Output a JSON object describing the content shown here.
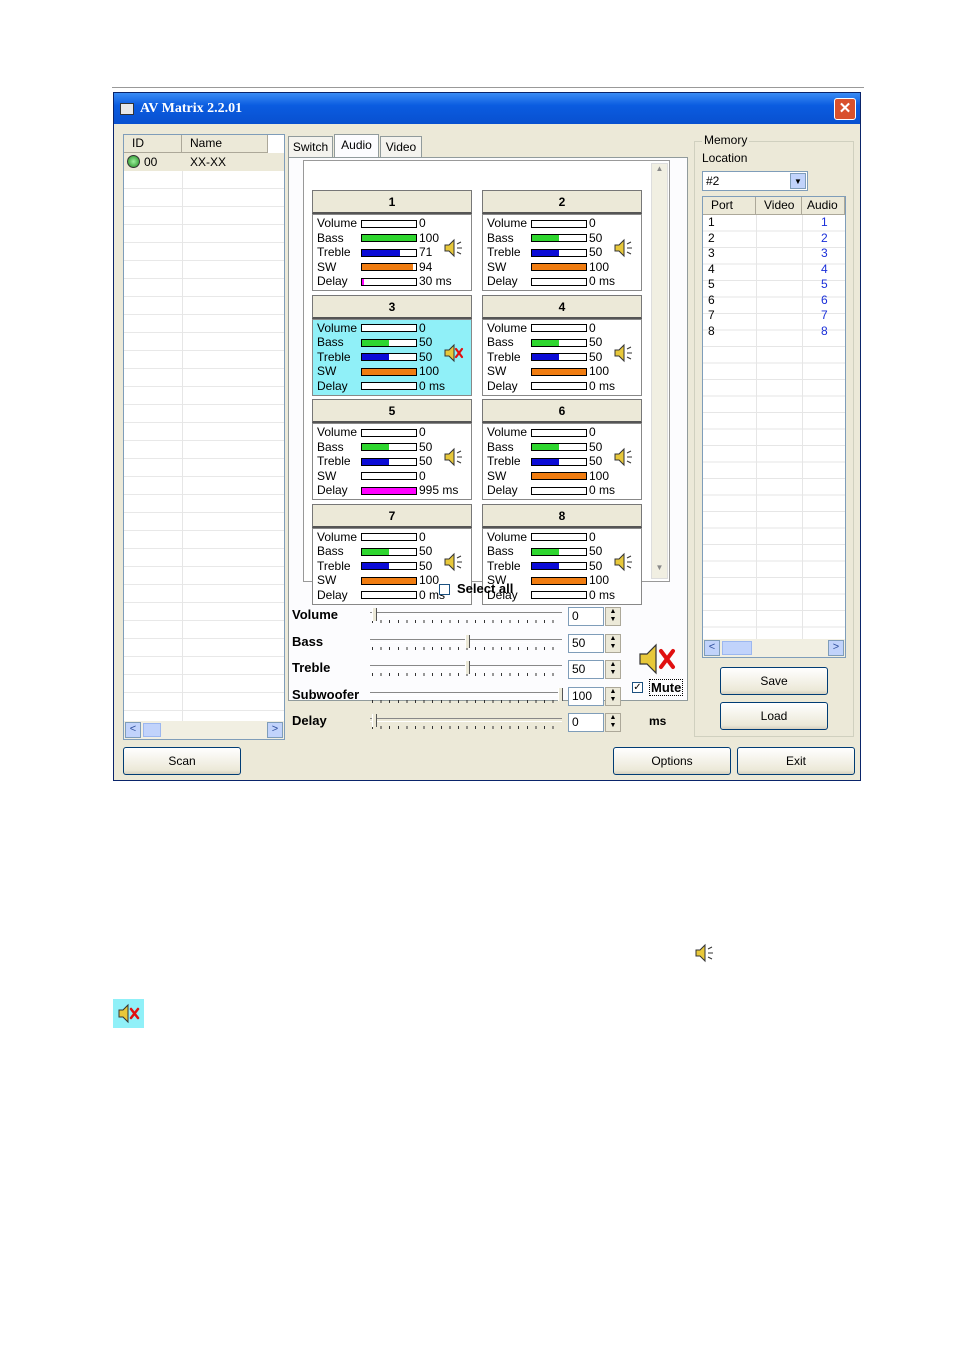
{
  "window": {
    "title": "AV Matrix 2.2.01"
  },
  "device_list": {
    "columns": [
      "ID",
      "Name"
    ],
    "rows": [
      {
        "id": "00",
        "name": "XX-XX"
      }
    ]
  },
  "tabs": [
    "Switch",
    "Audio",
    "Video"
  ],
  "selected_tab": "Audio",
  "zones": [
    {
      "title": "1",
      "volume": 0,
      "bass": 100,
      "treble": 71,
      "sw": 94,
      "delay_label": "30 ms",
      "delay_ms": 30,
      "muted": false,
      "selected": false
    },
    {
      "title": "2",
      "volume": 0,
      "bass": 50,
      "treble": 50,
      "sw": 100,
      "delay_label": "0 ms",
      "delay_ms": 0,
      "muted": false,
      "selected": false
    },
    {
      "title": "3",
      "volume": 0,
      "bass": 50,
      "treble": 50,
      "sw": 100,
      "delay_label": "0 ms",
      "delay_ms": 0,
      "muted": true,
      "selected": true
    },
    {
      "title": "4",
      "volume": 0,
      "bass": 50,
      "treble": 50,
      "sw": 100,
      "delay_label": "0 ms",
      "delay_ms": 0,
      "muted": false,
      "selected": false
    },
    {
      "title": "5",
      "volume": 0,
      "bass": 50,
      "treble": 50,
      "sw": 0,
      "delay_label": "995 ms",
      "delay_ms": 995,
      "muted": false,
      "selected": false
    },
    {
      "title": "6",
      "volume": 0,
      "bass": 50,
      "treble": 50,
      "sw": 100,
      "delay_label": "0 ms",
      "delay_ms": 0,
      "muted": false,
      "selected": false
    },
    {
      "title": "7",
      "volume": 0,
      "bass": 50,
      "treble": 50,
      "sw": 100,
      "delay_label": "0 ms",
      "delay_ms": 0,
      "muted": false,
      "selected": false
    },
    {
      "title": "8",
      "volume": 0,
      "bass": 50,
      "treble": 50,
      "sw": 100,
      "delay_label": "0 ms",
      "delay_ms": 0,
      "muted": false,
      "selected": false
    }
  ],
  "param_labels": {
    "volume": "Volume",
    "bass": "Bass",
    "treble": "Treble",
    "sw": "SW",
    "delay": "Delay"
  },
  "select_all_label": "Select all",
  "controls": {
    "volume": {
      "label": "Volume",
      "value": "0",
      "level": 0
    },
    "bass": {
      "label": "Bass",
      "value": "50",
      "level": 0.5
    },
    "treble": {
      "label": "Treble",
      "value": "50",
      "level": 0.5
    },
    "subwoofer": {
      "label": "Subwoofer",
      "value": "100",
      "level": 1
    },
    "delay": {
      "label": "Delay",
      "value": "0",
      "level": 0,
      "unit": "ms"
    }
  },
  "mute": {
    "label": "Mute",
    "checked": true
  },
  "memory": {
    "group_label": "Memory",
    "location_label": "Location",
    "location_value": "#2",
    "columns": [
      "Port",
      "Video",
      "Audio"
    ],
    "rows": [
      {
        "port": "1",
        "video": "",
        "audio": "1"
      },
      {
        "port": "2",
        "video": "",
        "audio": "2"
      },
      {
        "port": "3",
        "video": "",
        "audio": "3"
      },
      {
        "port": "4",
        "video": "",
        "audio": "4"
      },
      {
        "port": "5",
        "video": "",
        "audio": "5"
      },
      {
        "port": "6",
        "video": "",
        "audio": "6"
      },
      {
        "port": "7",
        "video": "",
        "audio": "7"
      },
      {
        "port": "8",
        "video": "",
        "audio": "8"
      }
    ],
    "save_label": "Save",
    "load_label": "Load"
  },
  "buttons": {
    "scan": "Scan",
    "options": "Options",
    "exit": "Exit"
  },
  "colors": {
    "bass": "#2ed62e",
    "treble": "#0b0bd6",
    "sw": "#f07c10",
    "delay": "#ff00ff",
    "selected_zone": "#90f0f8",
    "titlebar": "#0b5ce0"
  }
}
